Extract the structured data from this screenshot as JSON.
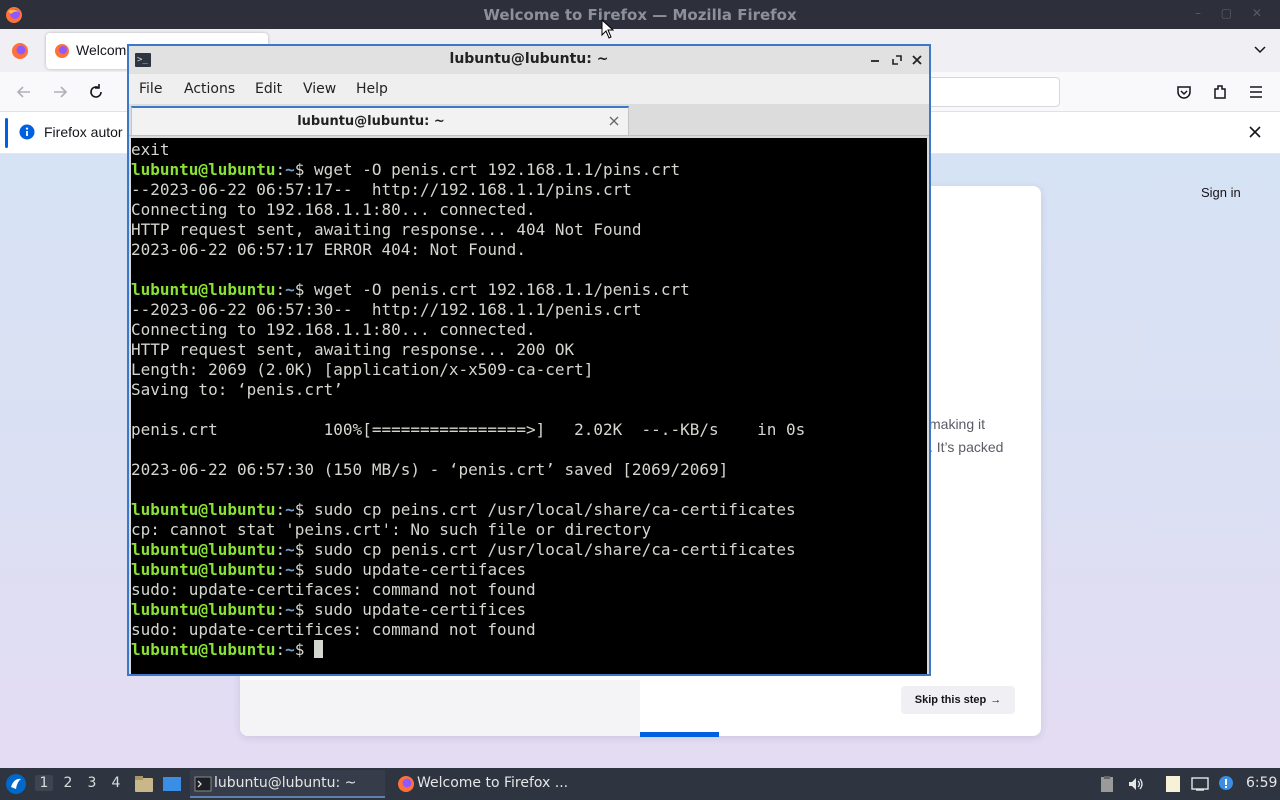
{
  "firefox": {
    "window_title": "Welcome to Firefox — Mozilla Firefox",
    "tab_label": "Welcom",
    "notification_text": "Firefox autor",
    "sign_in": "Sign in",
    "body_line_1": "making it",
    "body_line_2": ". It’s packed",
    "skip_button": "Skip this step",
    "skip_arrow": "→"
  },
  "terminal": {
    "window_title": "lubuntu@lubuntu: ~",
    "menu": [
      "File",
      "Actions",
      "Edit",
      "View",
      "Help"
    ],
    "tab_label": "lubuntu@lubuntu: ~",
    "prompt_user": "lubuntu@lubuntu",
    "prompt_sep": ":",
    "prompt_path": "~",
    "prompt_symbol": "$ ",
    "lines": [
      {
        "type": "out",
        "text": "exit"
      },
      {
        "type": "cmd",
        "text": "wget -O penis.crt 192.168.1.1/pins.crt"
      },
      {
        "type": "out",
        "text": "--2023-06-22 06:57:17--  http://192.168.1.1/pins.crt"
      },
      {
        "type": "out",
        "text": "Connecting to 192.168.1.1:80... connected."
      },
      {
        "type": "out",
        "text": "HTTP request sent, awaiting response... 404 Not Found"
      },
      {
        "type": "out",
        "text": "2023-06-22 06:57:17 ERROR 404: Not Found."
      },
      {
        "type": "out",
        "text": ""
      },
      {
        "type": "cmd",
        "text": "wget -O penis.crt 192.168.1.1/penis.crt"
      },
      {
        "type": "out",
        "text": "--2023-06-22 06:57:30--  http://192.168.1.1/penis.crt"
      },
      {
        "type": "out",
        "text": "Connecting to 192.168.1.1:80... connected."
      },
      {
        "type": "out",
        "text": "HTTP request sent, awaiting response... 200 OK"
      },
      {
        "type": "out",
        "text": "Length: 2069 (2.0K) [application/x-x509-ca-cert]"
      },
      {
        "type": "out",
        "text": "Saving to: ‘penis.crt’"
      },
      {
        "type": "out",
        "text": ""
      },
      {
        "type": "out",
        "text": "penis.crt           100%[================>]   2.02K  --.-KB/s    in 0s"
      },
      {
        "type": "out",
        "text": ""
      },
      {
        "type": "out",
        "text": "2023-06-22 06:57:30 (150 MB/s) - ‘penis.crt’ saved [2069/2069]"
      },
      {
        "type": "out",
        "text": ""
      },
      {
        "type": "cmd",
        "text": "sudo cp peins.crt /usr/local/share/ca-certificates"
      },
      {
        "type": "out",
        "text": "cp: cannot stat 'peins.crt': No such file or directory"
      },
      {
        "type": "cmd",
        "text": "sudo cp penis.crt /usr/local/share/ca-certificates"
      },
      {
        "type": "cmd",
        "text": "sudo update-certifaces"
      },
      {
        "type": "out",
        "text": "sudo: update-certifaces: command not found"
      },
      {
        "type": "cmd",
        "text": "sudo update-certifices"
      },
      {
        "type": "out",
        "text": "sudo: update-certifices: command not found"
      },
      {
        "type": "prompt",
        "text": ""
      }
    ]
  },
  "taskbar": {
    "workspaces": [
      "1",
      "2",
      "3",
      "4"
    ],
    "active_workspace": "1",
    "tasks": [
      {
        "label": "lubuntu@lubuntu: ~",
        "icon": "terminal-icon",
        "active": true
      },
      {
        "label": "Welcome to Firefox ...",
        "icon": "firefox-icon",
        "active": false
      }
    ],
    "clock": "6:59"
  },
  "colors": {
    "prompt_user": "#8ae234",
    "prompt_path": "#729fcf",
    "terminal_text": "#d3d7cf",
    "taskbar_bg": "#2e3440",
    "firefox_accent": "#0060df"
  }
}
